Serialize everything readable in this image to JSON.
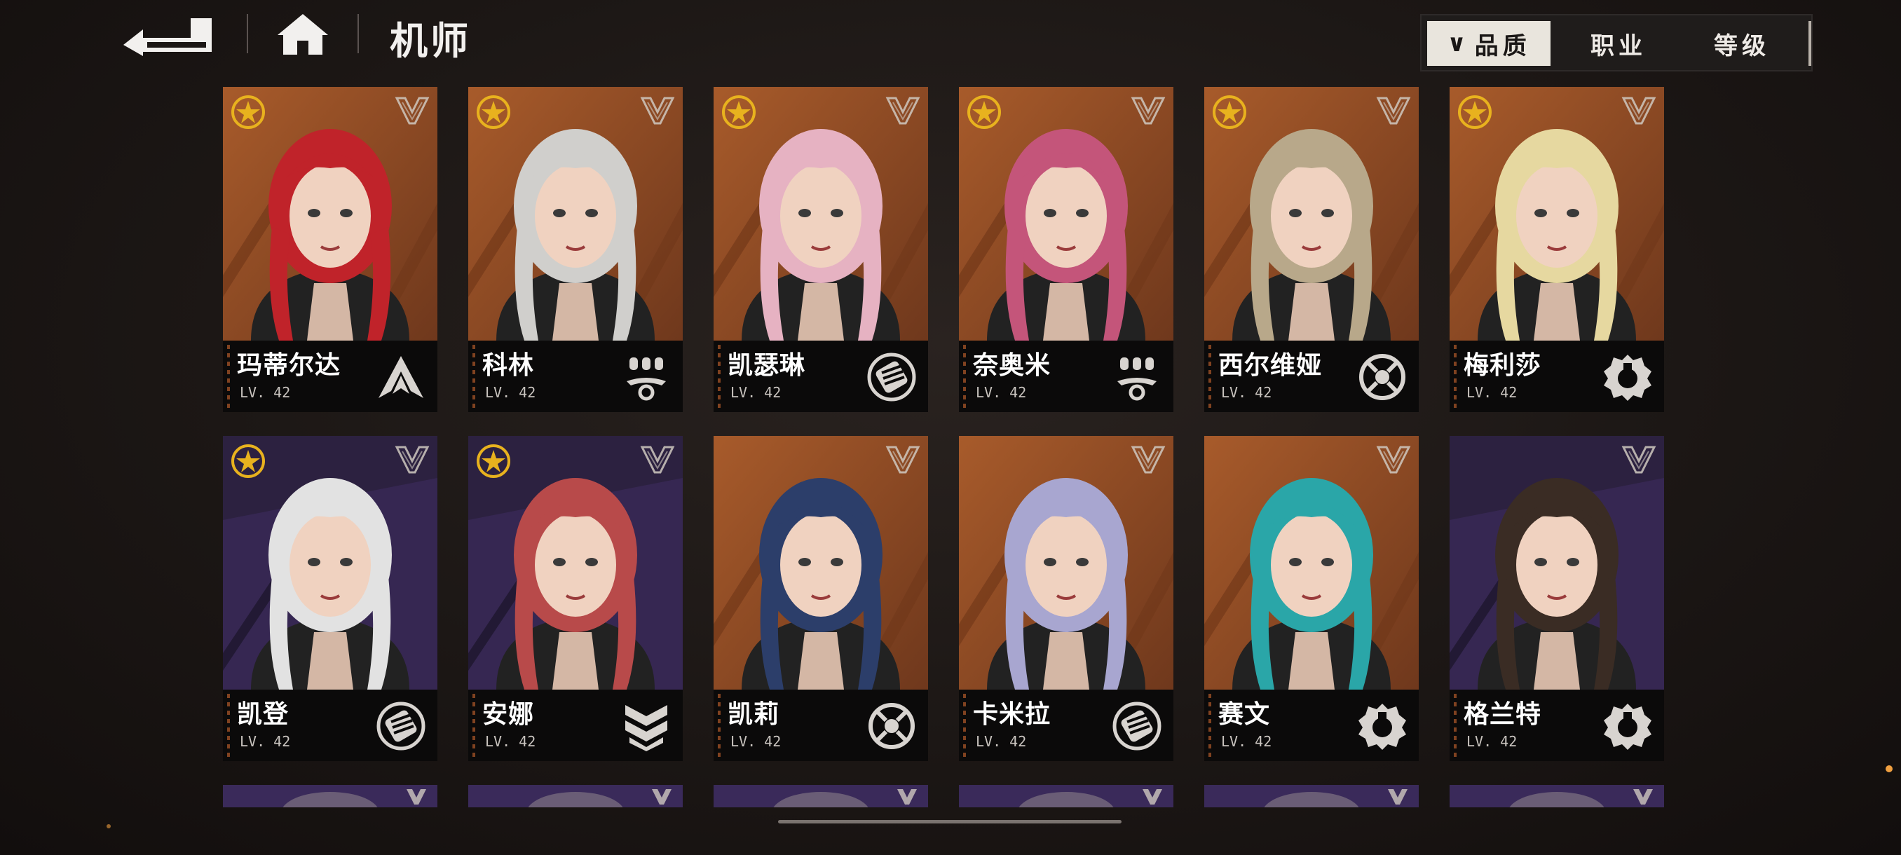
{
  "header": {
    "title": "机师",
    "back_icon": "back-arrow-icon",
    "home_icon": "home-icon"
  },
  "filters": [
    {
      "label": "品质",
      "active": true,
      "prefix": "∨"
    },
    {
      "label": "职业",
      "active": false
    },
    {
      "label": "等级",
      "active": false
    }
  ],
  "colors": {
    "orange_bg": "#a8582c",
    "purple_bg": "#3a2a5a",
    "dark_bg": "#1a1716",
    "gold": "#e8b21e",
    "filter_active": "#e9e5dd"
  },
  "pilots": [
    {
      "name": "玛蒂尔达",
      "level": "LV. 42",
      "bg": "orange",
      "star": true,
      "class_icon": "arrow-chevron-icon",
      "hair": "#c0232a"
    },
    {
      "name": "科林",
      "level": "LV. 42",
      "bg": "orange",
      "star": true,
      "class_icon": "drone-support-icon",
      "hair": "#d0cfcc"
    },
    {
      "name": "凯瑟琳",
      "level": "LV. 42",
      "bg": "orange",
      "star": true,
      "class_icon": "fist-icon",
      "hair": "#e6b2c2"
    },
    {
      "name": "奈奥米",
      "level": "LV. 42",
      "bg": "orange",
      "star": true,
      "class_icon": "drone-support-icon",
      "hair": "#c4557a"
    },
    {
      "name": "西尔维娅",
      "level": "LV. 42",
      "bg": "orange",
      "star": true,
      "class_icon": "target-icon",
      "hair": "#b8a88a"
    },
    {
      "name": "梅利莎",
      "level": "LV. 42",
      "bg": "orange",
      "star": true,
      "class_icon": "wrench-gear-icon",
      "hair": "#e6d8a0"
    },
    {
      "name": "凯登",
      "level": "LV. 42",
      "bg": "purple",
      "star": true,
      "class_icon": "fist-icon",
      "hair": "#e2e2e2"
    },
    {
      "name": "安娜",
      "level": "LV. 42",
      "bg": "purple",
      "star": true,
      "class_icon": "shield-chevron-icon",
      "hair": "#b84a4a"
    },
    {
      "name": "凯莉",
      "level": "LV. 42",
      "bg": "orange",
      "star": false,
      "class_icon": "target-icon",
      "hair": "#2c3e6a"
    },
    {
      "name": "卡米拉",
      "level": "LV. 42",
      "bg": "orange",
      "star": false,
      "class_icon": "fist-icon",
      "hair": "#a8a6d0"
    },
    {
      "name": "赛文",
      "level": "LV. 42",
      "bg": "orange",
      "star": false,
      "class_icon": "wrench-gear-icon",
      "hair": "#2aa6a8"
    },
    {
      "name": "格兰特",
      "level": "LV. 42",
      "bg": "purple",
      "star": false,
      "class_icon": "wrench-gear-icon",
      "hair": "#3a2c24"
    }
  ]
}
